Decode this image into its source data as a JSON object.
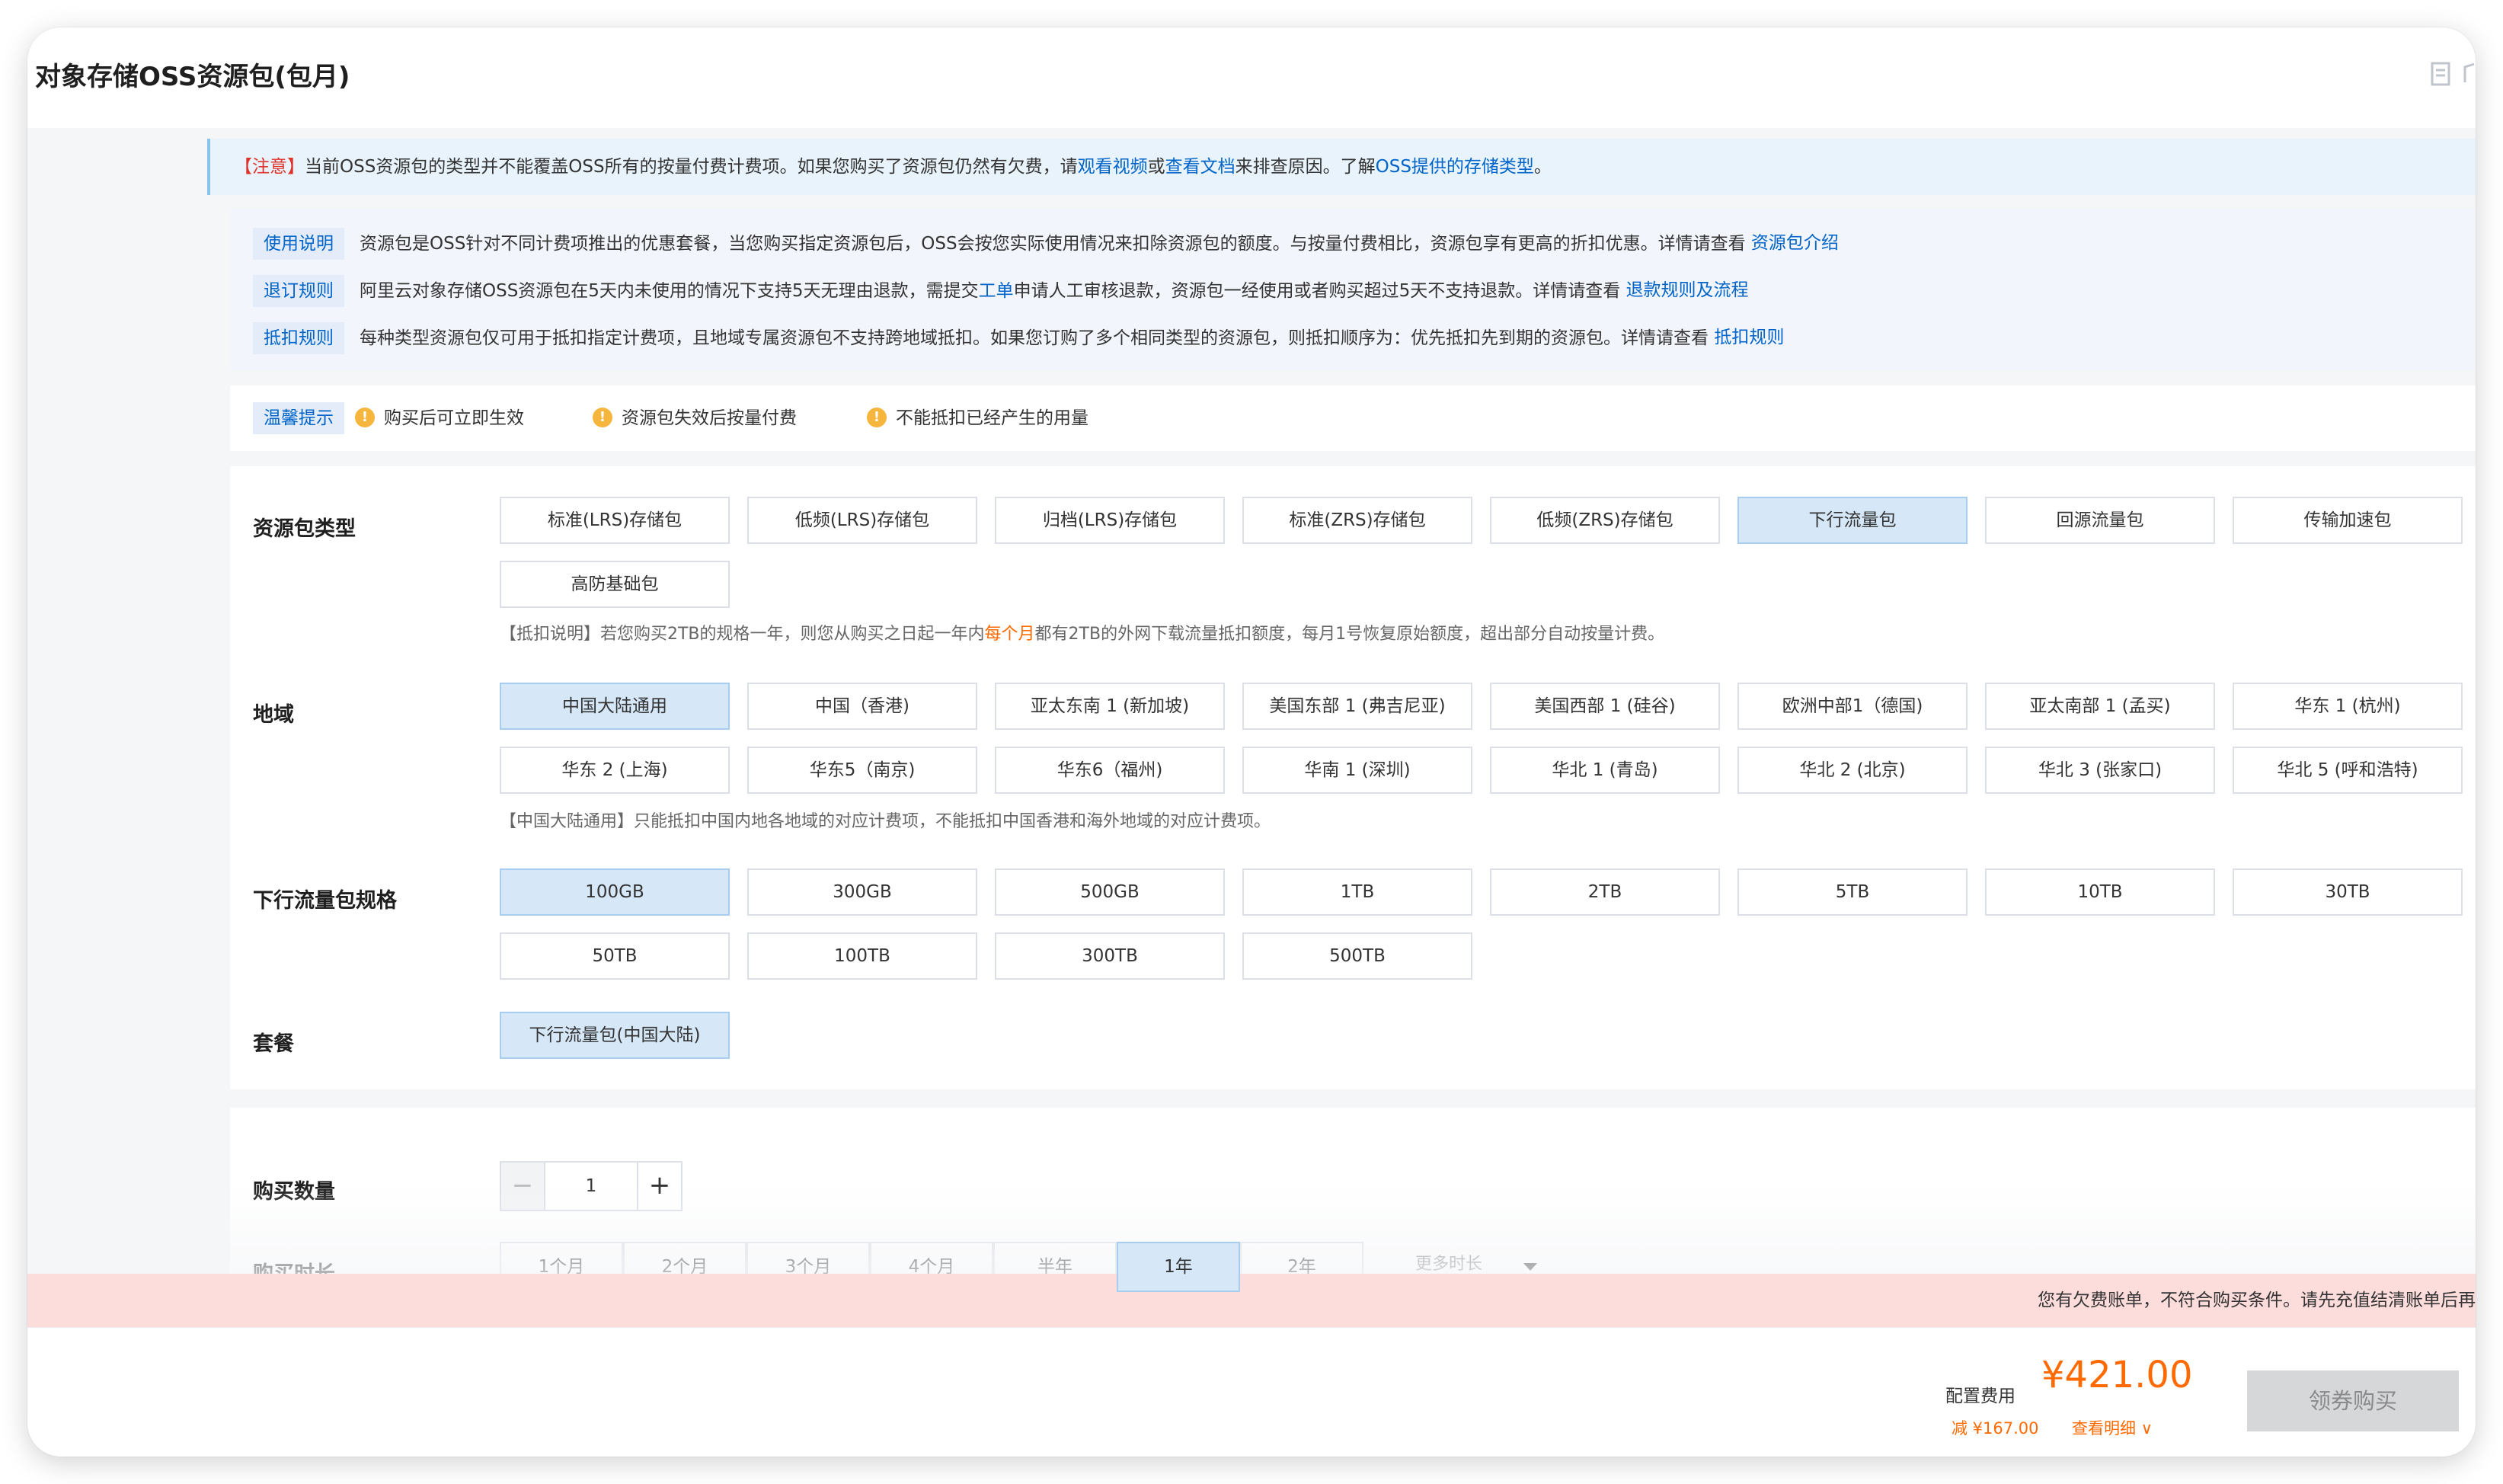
{
  "header": {
    "title": "对象存储OSS资源包(包月)",
    "icons": [
      "document-icon",
      "edit-icon"
    ]
  },
  "banner": {
    "warn_label": "【注意】",
    "text_1": "当前OSS资源包的类型并不能覆盖OSS所有的按量付费计费项。如果您购买了资源包仍然有欠费，请",
    "link_video": "观看视频",
    "text_or": "或",
    "link_doc": "查看文档",
    "text_2": "来排查原因。了解",
    "link_storage_types": "OSS提供的存储类型",
    "text_end": "。"
  },
  "rules": [
    {
      "tag": "使用说明",
      "text": "资源包是OSS针对不同计费项推出的优惠套餐，当您购买指定资源包后，OSS会按您实际使用情况来扣除资源包的额度。与按量付费相比，资源包享有更高的折扣优惠。详情请查看",
      "link": "资源包介绍"
    },
    {
      "tag": "退订规则",
      "text_a": "阿里云对象存储OSS资源包在5天内未使用的情况下支持5天无理由退款，需提交",
      "mid_link": "工单",
      "text_b": "申请人工审核退款，资源包一经使用或者购买超过5天不支持退款。详情请查看",
      "link": "退款规则及流程"
    },
    {
      "tag": "抵扣规则",
      "text": "每种类型资源包仅可用于抵扣指定计费项，且地域专属资源包不支持跨地域抵扣。如果您订购了多个相同类型的资源包，则抵扣顺序为：优先抵扣先到期的资源包。详情请查看",
      "link": "抵扣规则"
    }
  ],
  "tips": {
    "tag": "温馨提示",
    "items": [
      "购买后可立即生效",
      "资源包失效后按量付费",
      "不能抵扣已经产生的用量"
    ]
  },
  "package_type": {
    "label": "资源包类型",
    "options": [
      "标准(LRS)存储包",
      "低频(LRS)存储包",
      "归档(LRS)存储包",
      "标准(ZRS)存储包",
      "低频(ZRS)存储包",
      "下行流量包",
      "回源流量包",
      "传输加速包",
      "高防基础包"
    ],
    "selected": "下行流量包",
    "note_a": "【抵扣说明】若您购买2TB的规格一年，则您从购买之日起一年内",
    "note_hl": "每个月",
    "note_b": "都有2TB的外网下载流量抵扣额度，每月1号恢复原始额度，超出部分自动按量计费。"
  },
  "region": {
    "label": "地域",
    "options": [
      "中国大陆通用",
      "中国（香港)",
      "亚太东南 1 (新加坡)",
      "美国东部 1 (弗吉尼亚)",
      "美国西部 1 (硅谷)",
      "欧洲中部1（德国)",
      "亚太南部 1 (孟买)",
      "华东 1 (杭州)",
      "华东 2 (上海)",
      "华东5（南京)",
      "华东6（福州)",
      "华南 1 (深圳)",
      "华北 1 (青岛)",
      "华北 2 (北京)",
      "华北 3 (张家口)",
      "华北 5 (呼和浩特)"
    ],
    "selected": "中国大陆通用",
    "note": "【中国大陆通用】只能抵扣中国内地各地域的对应计费项，不能抵扣中国香港和海外地域的对应计费项。"
  },
  "spec": {
    "label": "下行流量包规格",
    "options": [
      "100GB",
      "300GB",
      "500GB",
      "1TB",
      "2TB",
      "5TB",
      "10TB",
      "30TB",
      "50TB",
      "100TB",
      "300TB",
      "500TB"
    ],
    "selected": "100GB"
  },
  "plan": {
    "label": "套餐",
    "options": [
      "下行流量包(中国大陆)"
    ],
    "selected": "下行流量包(中国大陆)"
  },
  "quantity": {
    "label": "购买数量",
    "minus": "−",
    "value": "1",
    "plus": "+"
  },
  "duration": {
    "label": "购买时长",
    "options": [
      "1个月",
      "2个月",
      "3个月",
      "4个月",
      "半年",
      "1年",
      "2年"
    ],
    "selected": "1年",
    "more": "更多时长"
  },
  "alert": {
    "text": "您有欠费账单，不符合购买条件。请先充值结清账单后再"
  },
  "footer": {
    "fee_label": "配置费用",
    "price": "¥421.00",
    "discount": "减 ¥167.00",
    "detail": "查看明细 ∨",
    "buy_button": "领券购买"
  },
  "colors": {
    "accent": "#0064c8",
    "price": "#ff6a00",
    "selected_bg": "#d6e8f8",
    "alert_bg": "#fddcdc",
    "tip_icon": "#f6b53c"
  }
}
